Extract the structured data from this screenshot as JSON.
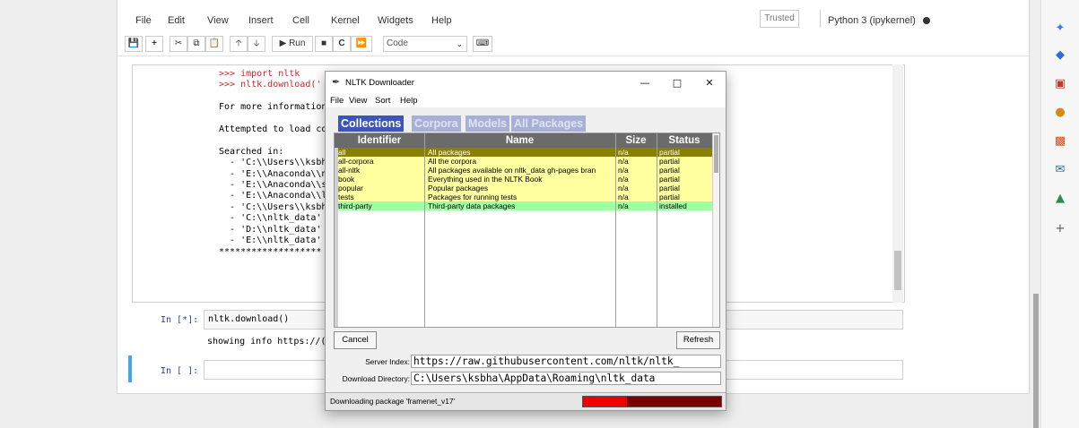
{
  "notebook": {
    "menu": [
      "File",
      "Edit",
      "View",
      "Insert",
      "Cell",
      "Kernel",
      "Widgets",
      "Help"
    ],
    "trusted": "Trusted",
    "kernel": "Python 3 (ipykernel)",
    "toolbar": {
      "run_label": "Run",
      "cell_type": "Code"
    },
    "output_lines": {
      "l1": ">>> import nltk",
      "l2": ">>> nltk.download('",
      "l4": "For more information",
      "l6": "Attempted to load co",
      "l8": "Searched in:",
      "l9": "  - 'C:\\\\Users\\\\ksbh",
      "l10": "  - 'E:\\\\Anaconda\\\\n",
      "l11": "  - 'E:\\\\Anaconda\\\\s",
      "l12": "  - 'E:\\\\Anaconda\\\\l",
      "l13": "  - 'C:\\\\Users\\\\ksbh",
      "l14": "  - 'C:\\\\nltk_data'",
      "l15": "  - 'D:\\\\nltk_data'",
      "l16": "  - 'E:\\\\nltk_data'",
      "l17": "*******************"
    },
    "cell2_prompt": "In [*]:",
    "cell2_code": "nltk.download()",
    "cell2_output": "showing info https://(",
    "cell3_prompt": "In [ ]:",
    "cell3_code": ""
  },
  "downloader": {
    "title": "NLTK Downloader",
    "menu": [
      "File",
      "View",
      "Sort",
      "Help"
    ],
    "tabs": [
      "Collections",
      "Corpora",
      "Models",
      "All Packages"
    ],
    "columns": [
      "Identifier",
      "Name",
      "Size",
      "Status"
    ],
    "rows": [
      {
        "id": "all",
        "name": "All packages",
        "size": "n/a",
        "status": "partial"
      },
      {
        "id": "all-corpora",
        "name": "All the corpora",
        "size": "n/a",
        "status": "partial"
      },
      {
        "id": "all-nltk",
        "name": "All packages available on nltk_data gh-pages bran",
        "size": "n/a",
        "status": "partial"
      },
      {
        "id": "book",
        "name": "Everything used in the NLTK Book",
        "size": "n/a",
        "status": "partial"
      },
      {
        "id": "popular",
        "name": "Popular packages",
        "size": "n/a",
        "status": "partial"
      },
      {
        "id": "tests",
        "name": "Packages for running tests",
        "size": "n/a",
        "status": "partial"
      },
      {
        "id": "third-party",
        "name": "Third-party data packages",
        "size": "n/a",
        "status": "installed"
      }
    ],
    "cancel_label": "Cancel",
    "refresh_label": "Refresh",
    "server_index_label": "Server Index:",
    "server_index_value": "https://raw.githubusercontent.com/nltk/nltk_",
    "download_dir_label": "Download Directory:",
    "download_dir_value": "C:\\Users\\ksbha\\AppData\\Roaming\\nltk_data",
    "status_text": "Downloading package 'framenet_v17'",
    "progress_fraction": 0.32,
    "colors": {
      "tab_active": "#3b55b8",
      "row_selected": "#8a8000",
      "row_partial": "#ffffa0",
      "row_installed": "#a0ffa0",
      "progress": "#ee0000"
    }
  }
}
